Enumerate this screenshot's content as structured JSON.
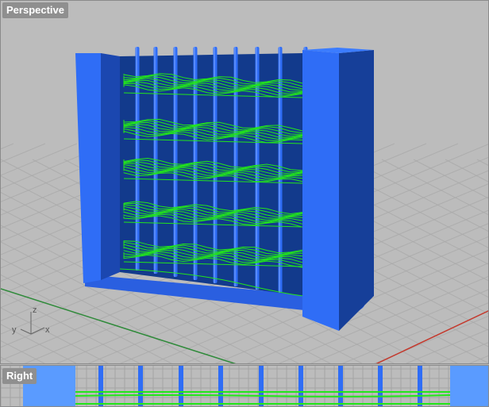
{
  "viewports": {
    "perspective": {
      "title": "Perspective"
    },
    "right": {
      "title": "Right"
    }
  },
  "axes": {
    "z": "z",
    "y": "y",
    "x": "x"
  },
  "colors": {
    "background": "#bcbcbc",
    "grid": "#a9a9a9",
    "model_blue": "#2f6df6",
    "model_dark": "#163f99",
    "toolpath_green": "#22e61a",
    "x_axis": "#c43a2e",
    "y_axis": "#2f8a3a"
  }
}
